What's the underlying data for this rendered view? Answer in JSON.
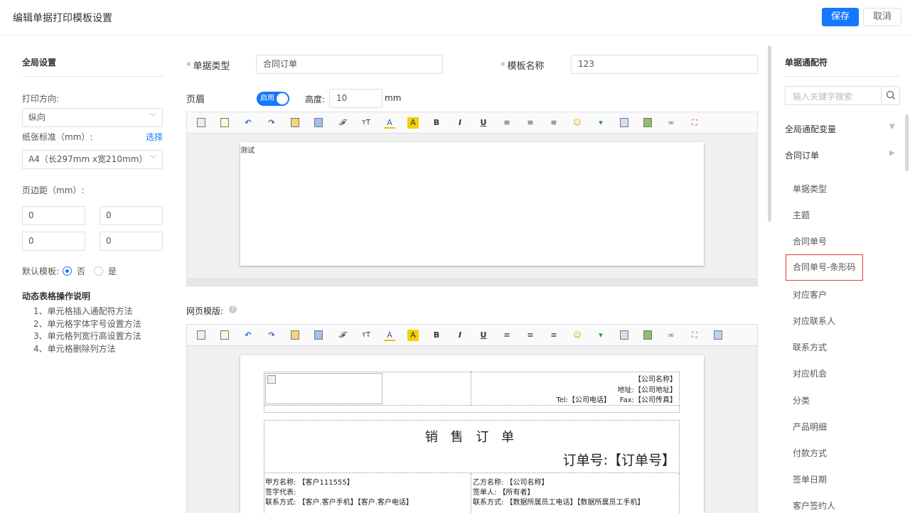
{
  "header": {
    "title": "编辑单据打印模板设置",
    "save": "保存",
    "cancel": "取消"
  },
  "global": {
    "title": "全局设置",
    "orientation_label": "打印方向:",
    "orientation_value": "纵向",
    "paper_label": "纸张标准（mm）:",
    "paper_choose": "选择",
    "paper_value": "A4（长297mm x宽210mm）",
    "margin_label": "页边距（mm）:",
    "margins": [
      "0",
      "0",
      "0",
      "0"
    ],
    "default_label": "默认模板:",
    "default_no": "否",
    "default_yes": "是"
  },
  "help": {
    "title": "动态表格操作说明",
    "items": [
      "1、单元格插入通配符方法",
      "2、单元格字体字号设置方法",
      "3、单元格列宽行高设置方法",
      "4、单元格删除列方法"
    ]
  },
  "form": {
    "type_label": "单据类型",
    "type_value": "合同订单",
    "name_label": "模板名称",
    "name_value": "123",
    "header_label": "页眉",
    "switch_label": "启用",
    "height_label": "高度:",
    "height_value": "10",
    "height_unit": "mm",
    "header_text": "测试",
    "web_label": "网页模版:"
  },
  "doc": {
    "company": "【公司名称】",
    "address": "地址:【公司地址】",
    "tel": "Tel:【公司电话】",
    "fax": "Fax:【公司传真】",
    "title": "销 售 订 单",
    "order_no": "订单号:【订单号】",
    "party_a": "甲方名称: 【客户111555】",
    "sign_rep": "签字代表:",
    "contact_a": "联系方式: 【客户.客户手机】【客户.客户电话】",
    "party_b": "乙方名称: 【公司名称】",
    "signer": "签单人: 【所有者】",
    "contact_b": "联系方式: 【数据所属员工电话】【数据所属员工手机】"
  },
  "right": {
    "title": "单据通配符",
    "search_placeholder": "输入关键字搜索",
    "groups": [
      "全局通配变量",
      "合同订单"
    ],
    "vars": [
      "单据类型",
      "主题",
      "合同单号",
      "合同单号-条形码",
      "对应客户",
      "对应联系人",
      "联系方式",
      "对应机会",
      "分类",
      "产品明细",
      "付款方式",
      "签单日期",
      "客户签约人"
    ]
  }
}
